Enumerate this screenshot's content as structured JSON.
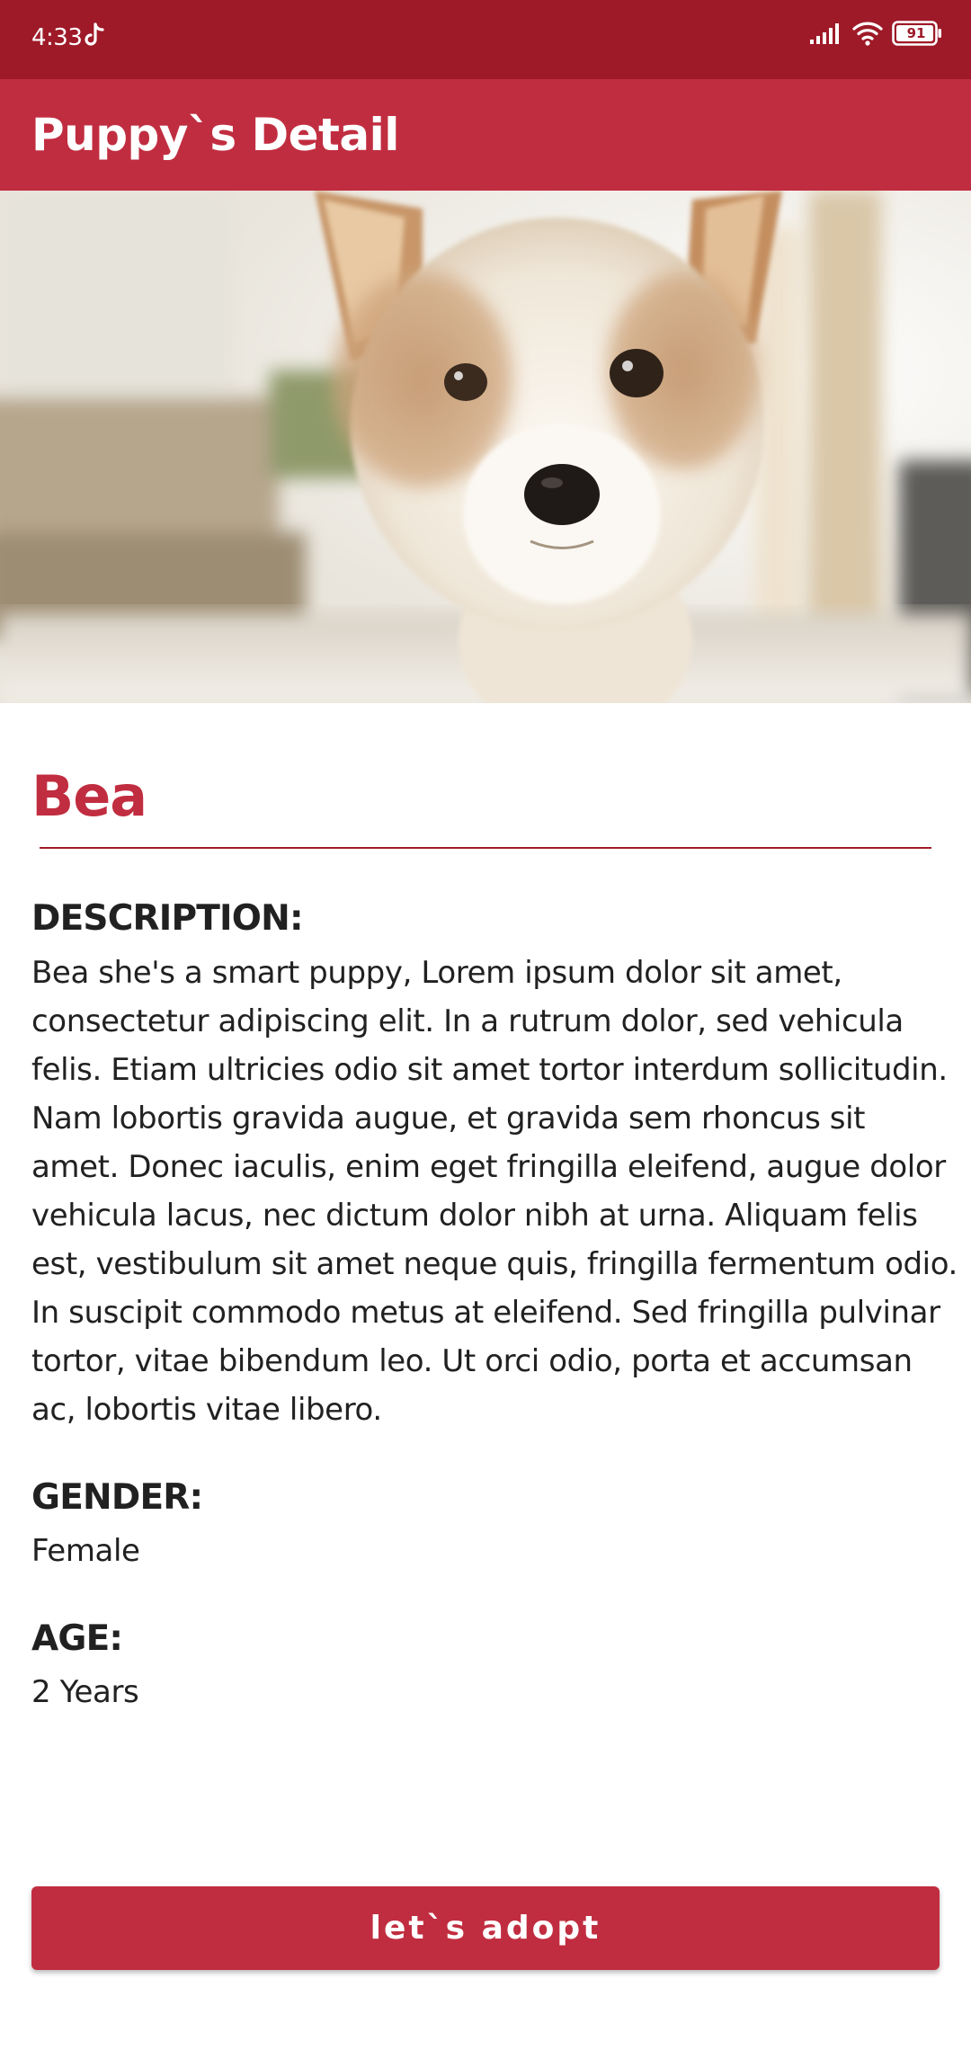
{
  "status_bar": {
    "time": "4:33",
    "battery": "91",
    "icons": [
      "tiktok-icon",
      "signal-icon",
      "wifi-icon",
      "battery-icon"
    ]
  },
  "app_bar": {
    "title": "Puppy`s Detail"
  },
  "hero_image": {
    "subject": "puppy-photo"
  },
  "pet": {
    "name": "Bea",
    "description_label": "DESCRIPTION:",
    "description": "Bea she's a smart puppy, Lorem ipsum dolor sit amet, consectetur adipiscing elit. In a rutrum dolor, sed vehicula felis. Etiam ultricies odio sit amet tortor interdum sollicitudin. Nam lobortis gravida augue, et gravida sem rhoncus sit amet. Donec iaculis, enim eget fringilla eleifend, augue dolor vehicula lacus, nec dictum dolor nibh at urna. Aliquam felis est, vestibulum sit amet neque quis, fringilla fermentum odio. In suscipit commodo metus at eleifend. Sed fringilla pulvinar tortor, vitae bibendum leo. Ut orci odio, porta et accumsan ac, lobortis vitae libero.",
    "gender_label": "GENDER:",
    "gender": "Female",
    "age_label": "AGE:",
    "age": "2 Years"
  },
  "actions": {
    "adopt_label": "let`s adopt"
  },
  "colors": {
    "status_bar": "#9e1a28",
    "primary": "#c12d40",
    "text": "#212121",
    "background": "#ffffff"
  }
}
